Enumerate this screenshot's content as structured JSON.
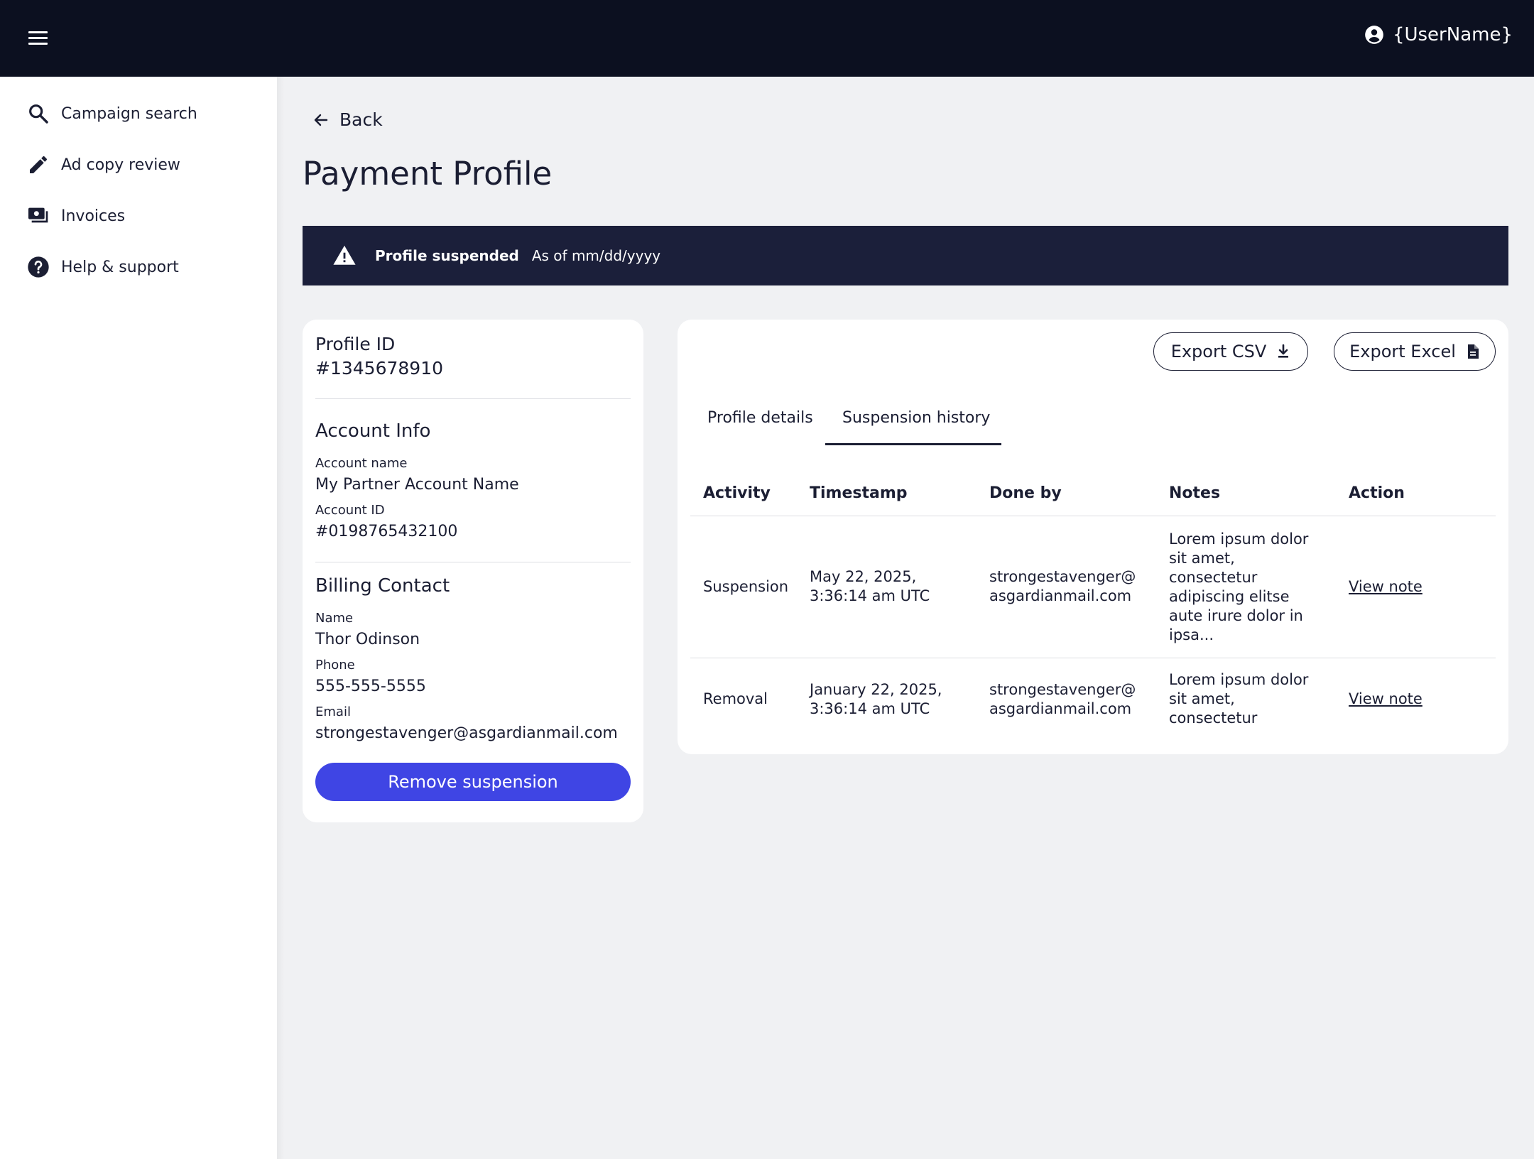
{
  "header": {
    "username": "{UserName}"
  },
  "sidebar": {
    "items": [
      {
        "label": "Campaign search",
        "icon": "search-icon"
      },
      {
        "label": "Ad copy review",
        "icon": "pencil-icon"
      },
      {
        "label": "Invoices",
        "icon": "money-icon"
      },
      {
        "label": "Help & support",
        "icon": "help-icon"
      }
    ]
  },
  "back_label": "Back",
  "page_title": "Payment Profile",
  "banner": {
    "status": "Profile suspended",
    "date": "As of mm/dd/yyyy",
    "icon": "warning-icon"
  },
  "profile": {
    "id_label": "Profile ID",
    "id_value": "#1345678910",
    "account_info_title": "Account Info",
    "account_name_label": "Account name",
    "account_name": "My Partner Account Name",
    "account_id_label": "Account ID",
    "account_id": "#0198765432100",
    "billing_title": "Billing Contact",
    "name_label": "Name",
    "name": "Thor Odinson",
    "phone_label": "Phone",
    "phone": "555-555-5555",
    "email_label": "Email",
    "email": "strongestavenger@asgardianmail.com",
    "remove_button": "Remove suspension"
  },
  "exports": {
    "csv": "Export CSV",
    "excel": "Export Excel"
  },
  "tabs": [
    {
      "label": "Profile details",
      "active": false
    },
    {
      "label": "Suspension history",
      "active": true
    }
  ],
  "table": {
    "headers": [
      "Activity",
      "Timestamp",
      "Done by",
      "Notes",
      "Action"
    ],
    "rows": [
      {
        "activity": "Suspension",
        "timestamp": "May 22, 2025,\n3:36:14 am UTC",
        "done_by": "strongestavenger@\nasgardianmail.com",
        "notes": "Lorem ipsum dolor\nsit amet,\nconsectetur\nadipiscing elitse\naute irure dolor in\nipsa...",
        "action": "View note"
      },
      {
        "activity": "Removal",
        "timestamp": "January 22, 2025,\n3:36:14 am UTC",
        "done_by": "strongestavenger@\nasgardianmail.com",
        "notes": "Lorem ipsum dolor\nsit amet,\nconsectetur",
        "action": "View note"
      }
    ]
  },
  "colors": {
    "topbar": "#0c1020",
    "banner": "#1b1f3a",
    "primary": "#3f45e4",
    "background": "#f0f1f3"
  }
}
